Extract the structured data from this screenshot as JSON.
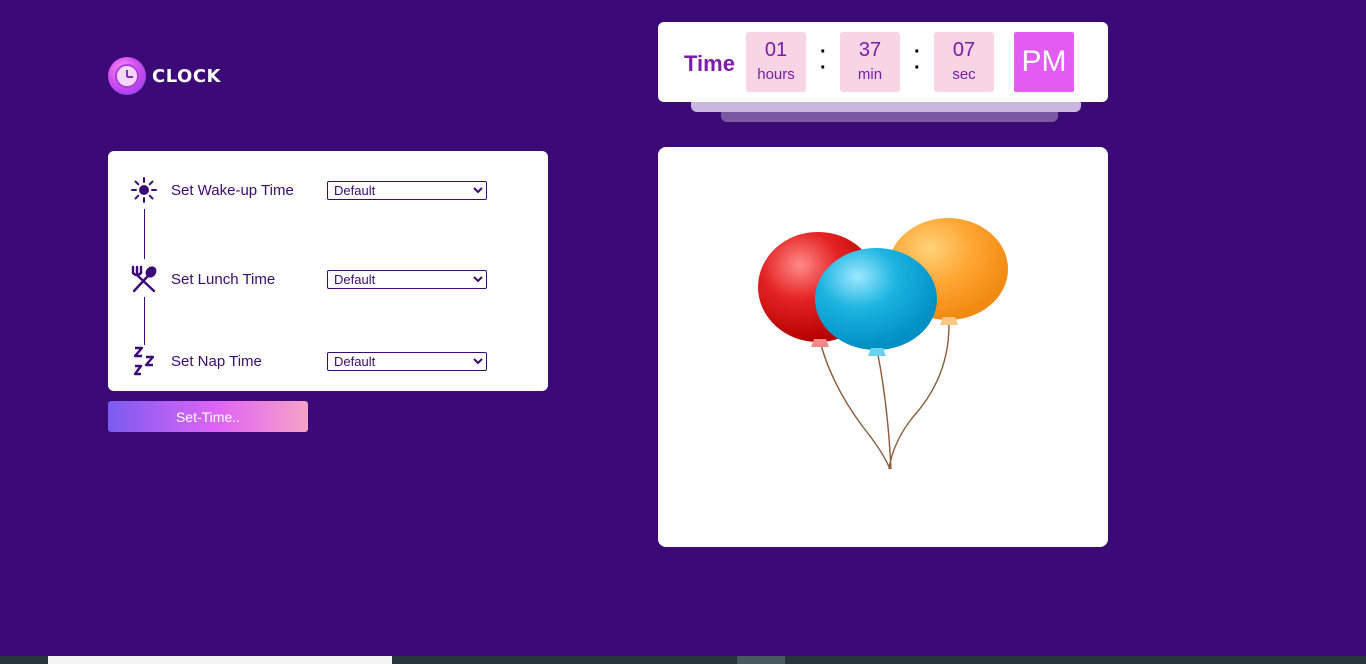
{
  "logo": {
    "text": "CLOCK"
  },
  "settings": {
    "rows": [
      {
        "label": "Set Wake-up Time",
        "icon": "sun-icon",
        "value": "Default"
      },
      {
        "label": "Set Lunch Time",
        "icon": "fork-spoon-icon",
        "value": "Default"
      },
      {
        "label": "Set Nap Time",
        "icon": "sleep-zzz-icon",
        "value": "Default"
      }
    ],
    "button": "Set-Time.."
  },
  "clock": {
    "label": "Time",
    "hours": "01",
    "hours_unit": "hours",
    "minutes": "37",
    "minutes_unit": "min",
    "seconds": "07",
    "seconds_unit": "sec",
    "ampm": "PM"
  },
  "image": {
    "name": "balloons-illustration"
  },
  "colors": {
    "background": "#3c0a76",
    "accent": "#7d1aa8",
    "ampm_bg": "#e35cf1",
    "time_box": "#f7d5e5"
  }
}
